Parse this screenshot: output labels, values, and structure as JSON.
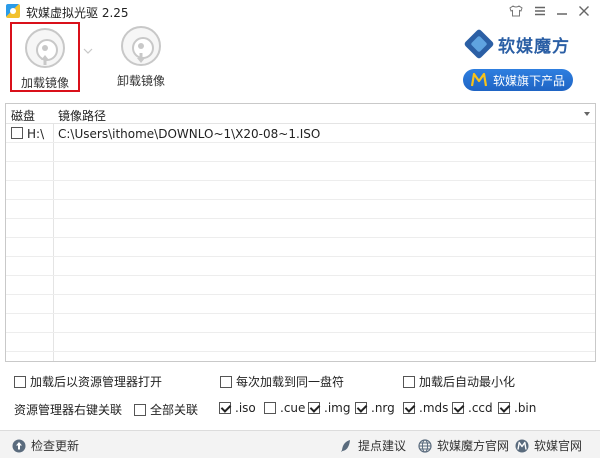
{
  "window": {
    "title": "软媒虚拟光驱 2.25",
    "controls": [
      "skin-icon",
      "menu-icon",
      "minimize-icon",
      "close-icon"
    ]
  },
  "toolbar": {
    "mount_label": "加载镜像",
    "unmount_label": "卸载镜像",
    "brand_text": "软媒魔方",
    "flagship_label": "软媒旗下产品"
  },
  "list": {
    "columns": [
      "磁盘",
      "镜像路径"
    ],
    "rows": [
      {
        "checked": false,
        "drive": "H:\\",
        "path": "C:\\Users\\ithome\\DOWNLO~1\\X20-08~1.ISO"
      }
    ]
  },
  "options": {
    "open_explorer_after_mount": "加载后以资源管理器打开",
    "mount_same_drive": "每次加载到同一盘符",
    "minimize_after_mount": "加载后自动最小化",
    "context_menu_label": "资源管理器右键关联",
    "associate_all": "全部关联",
    "extensions": [
      {
        "label": ".iso",
        "checked": true
      },
      {
        "label": ".cue",
        "checked": false
      },
      {
        "label": ".img",
        "checked": true
      },
      {
        "label": ".nrg",
        "checked": true
      },
      {
        "label": ".mds",
        "checked": true
      },
      {
        "label": ".ccd",
        "checked": true
      },
      {
        "label": ".bin",
        "checked": true
      }
    ]
  },
  "footer": {
    "check_update": "检查更新",
    "feedback": "提点建议",
    "mofang_site": "软媒魔方官网",
    "ruanmei_site": "软媒官网"
  },
  "colors": {
    "accent_blue": "#1f64c4",
    "brand_blue": "#2b5fa5",
    "selection_red": "#d9101a"
  }
}
